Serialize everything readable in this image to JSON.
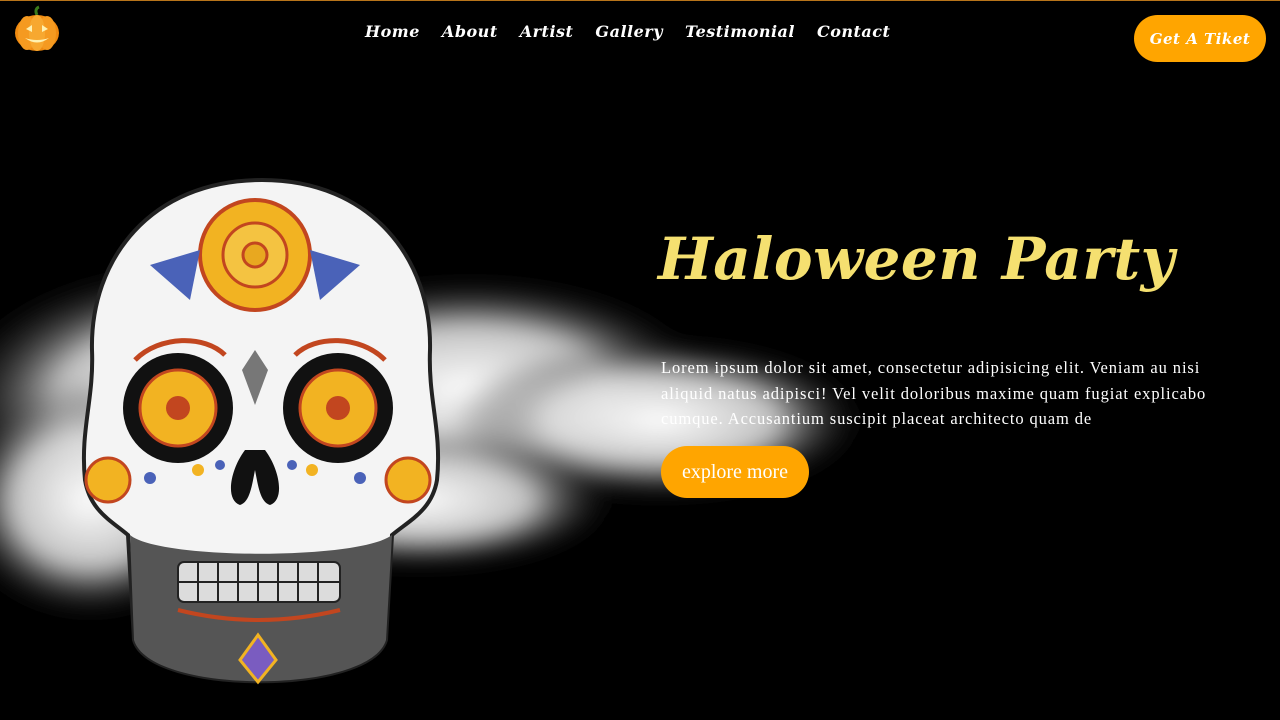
{
  "nav": {
    "logo_icon": "pumpkin-icon",
    "items": [
      {
        "label": "Home"
      },
      {
        "label": "About"
      },
      {
        "label": "Artist"
      },
      {
        "label": "Gallery"
      },
      {
        "label": "Testimonial"
      },
      {
        "label": "Contact"
      }
    ],
    "cta_label": "Get A Tiket"
  },
  "hero": {
    "title": "Haloween Party",
    "description": "Lorem ipsum dolor sit amet, consectetur adipisicing elit. Veniam au nisi aliquid natus adipisci! Vel velit doloribus maxime quam fugiat explicabo cumque. Accusantium suscipit placeat architecto quam de",
    "button_label": "explore more"
  },
  "colors": {
    "accent": "#ffa500",
    "title": "#f5e070",
    "background": "#000000"
  }
}
